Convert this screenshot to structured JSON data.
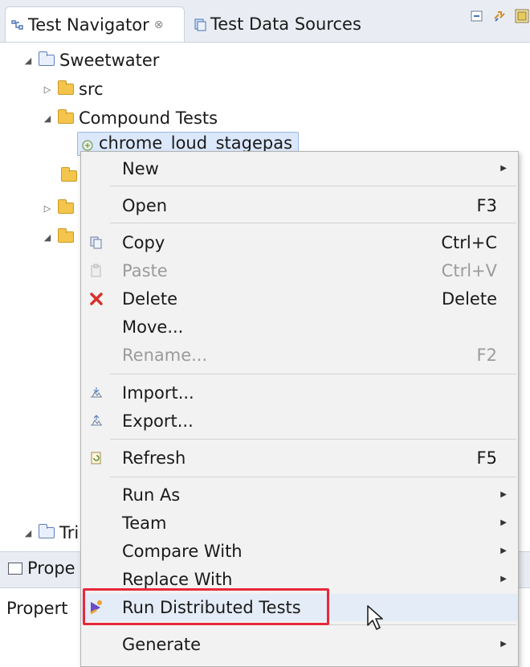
{
  "tabs": {
    "active": {
      "label": "Test Navigator",
      "close": "⊗",
      "icon": "test-navigator-icon"
    },
    "inactive": {
      "label": "Test Data Sources",
      "icon": "data-sources-icon"
    }
  },
  "toolbar": {
    "icons": [
      "collapse-all-icon",
      "link-with-editor-icon",
      "view-menu-icon"
    ]
  },
  "tree": {
    "project": "Sweetwater",
    "src": "src",
    "compound": "Compound Tests",
    "selected_item": "chrome_loud_stagepas",
    "second_project": "Tri"
  },
  "bottom_panel": {
    "tab": "Prope",
    "column_header": "Propert"
  },
  "menu": {
    "new": "New",
    "open": {
      "label": "Open",
      "shortcut": "F3"
    },
    "copy": {
      "label": "Copy",
      "shortcut": "Ctrl+C"
    },
    "paste": {
      "label": "Paste",
      "shortcut": "Ctrl+V"
    },
    "delete": {
      "label": "Delete",
      "shortcut": "Delete"
    },
    "move": "Move...",
    "rename": {
      "label": "Rename...",
      "shortcut": "F2"
    },
    "import": "Import...",
    "export": "Export...",
    "refresh": {
      "label": "Refresh",
      "shortcut": "F5"
    },
    "run_as": "Run As",
    "team": "Team",
    "compare_with": "Compare With",
    "replace_with": "Replace With",
    "run_distributed": "Run Distributed Tests",
    "generate": "Generate"
  },
  "colors": {
    "highlight": "#e8283a",
    "menu_bg": "#f2f2f2",
    "selection": "#dbe8fb"
  }
}
